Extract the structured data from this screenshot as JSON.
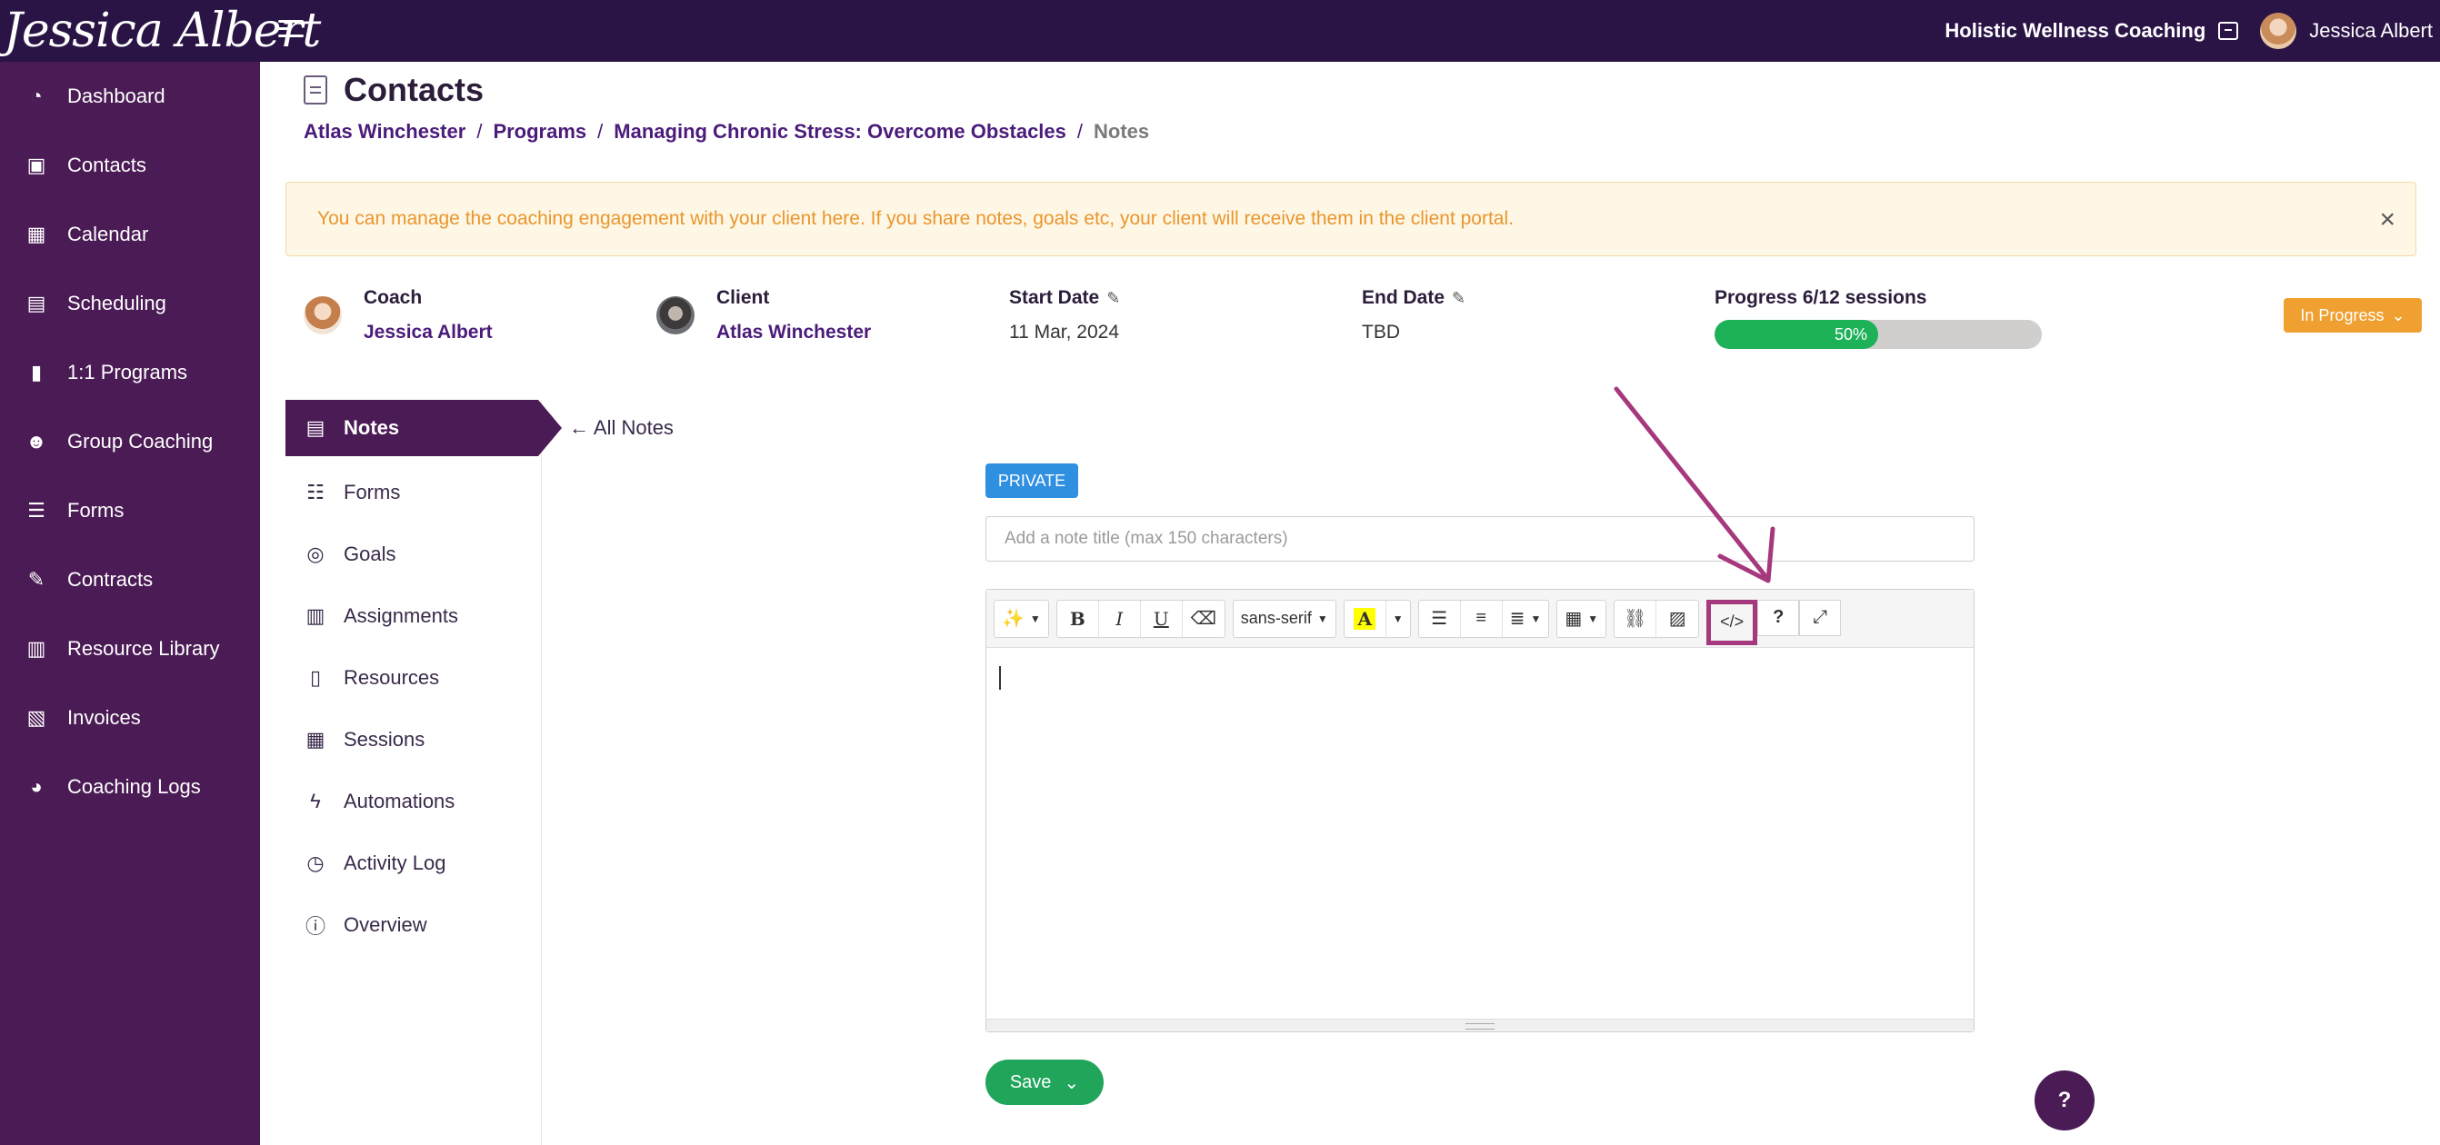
{
  "header": {
    "logo_text": "Jessica Albert",
    "business_name": "Holistic Wellness Coaching",
    "user_name": "Jessica Albert"
  },
  "sidebar": {
    "items": [
      {
        "label": "Dashboard",
        "icon": "dashboard-icon"
      },
      {
        "label": "Contacts",
        "icon": "contacts-icon"
      },
      {
        "label": "Calendar",
        "icon": "calendar-icon"
      },
      {
        "label": "Scheduling",
        "icon": "scheduling-icon"
      },
      {
        "label": "1:1 Programs",
        "icon": "book-icon"
      },
      {
        "label": "Group Coaching",
        "icon": "group-icon"
      },
      {
        "label": "Forms",
        "icon": "forms-icon"
      },
      {
        "label": "Contracts",
        "icon": "contract-icon"
      },
      {
        "label": "Resource Library",
        "icon": "library-icon"
      },
      {
        "label": "Invoices",
        "icon": "invoice-icon"
      },
      {
        "label": "Coaching Logs",
        "icon": "clock-icon"
      }
    ]
  },
  "page": {
    "title": "Contacts",
    "breadcrumb": [
      "Atlas Winchester",
      "Programs",
      "Managing Chronic Stress: Overcome Obstacles",
      "Notes"
    ],
    "breadcrumb_sep": "/"
  },
  "alert": {
    "text": "You can manage the coaching engagement with your client here. If you share notes, goals etc, your client will receive them in the client portal.",
    "close": "×"
  },
  "engagement": {
    "coach_label": "Coach",
    "coach_name": "Jessica Albert",
    "client_label": "Client",
    "client_name": "Atlas Winchester",
    "start_label": "Start Date",
    "start_value": "11 Mar, 2024",
    "end_label": "End Date",
    "end_value": "TBD",
    "progress_label": "Progress 6/12 sessions",
    "progress_percent_text": "50%",
    "progress_fraction": 0.5,
    "status": "In Progress"
  },
  "subnav": {
    "items": [
      {
        "label": "Notes",
        "icon": "notes-icon",
        "active": true
      },
      {
        "label": "Forms",
        "icon": "checklist-icon"
      },
      {
        "label": "Goals",
        "icon": "target-icon"
      },
      {
        "label": "Assignments",
        "icon": "clipboard-icon"
      },
      {
        "label": "Resources",
        "icon": "resources-icon"
      },
      {
        "label": "Sessions",
        "icon": "calendar-icon"
      },
      {
        "label": "Automations",
        "icon": "bolt-icon"
      },
      {
        "label": "Activity Log",
        "icon": "history-icon"
      },
      {
        "label": "Overview",
        "icon": "info-icon"
      }
    ]
  },
  "notes": {
    "back_label": "← All Notes",
    "visibility_badge": "PRIVATE",
    "title_placeholder": "Add a note title (max 150 characters)",
    "title_value": "",
    "toolbar": {
      "font_name": "sans-serif"
    },
    "save_label": "Save"
  },
  "help_label": "?",
  "colors": {
    "topbar": "#2a1446",
    "sidebar": "#4b1b55",
    "accent_orange": "#f0a030",
    "progress_green": "#1db158",
    "annotation_magenta": "#a6387e",
    "badge_blue": "#2f8fe0"
  }
}
